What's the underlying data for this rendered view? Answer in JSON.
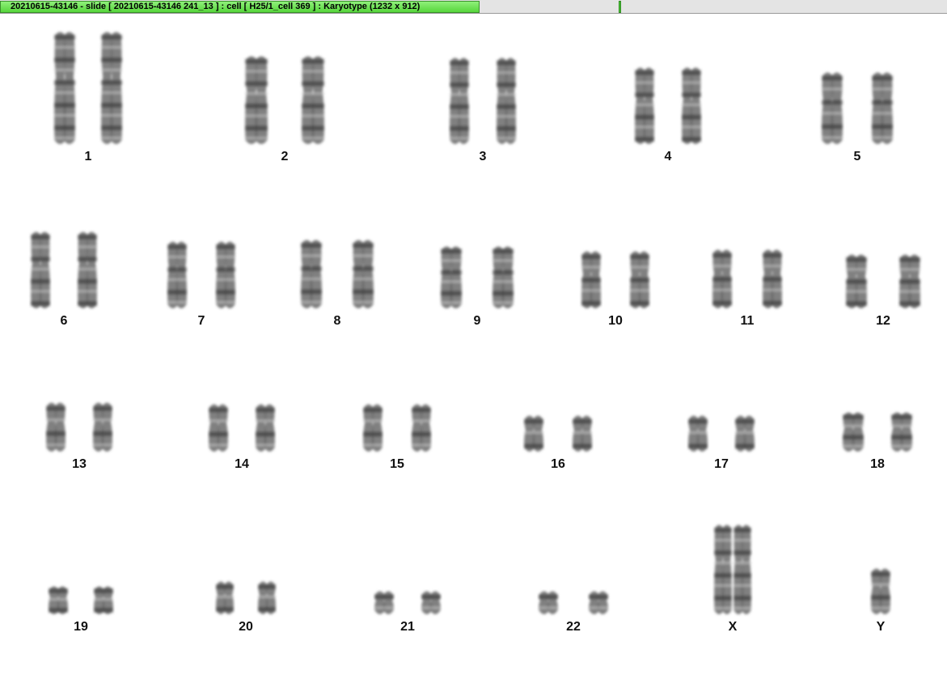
{
  "window": {
    "title": "20210615-43146 - slide [ 20210615-43146 241_13 ] : cell [ H25/1_cell 369 ] : Karyotype  (1232 x 912)"
  },
  "karyotype": {
    "labels": [
      "1",
      "2",
      "3",
      "4",
      "5",
      "6",
      "7",
      "8",
      "9",
      "10",
      "11",
      "12",
      "13",
      "14",
      "15",
      "16",
      "17",
      "18",
      "19",
      "20",
      "21",
      "22",
      "X",
      "Y"
    ]
  }
}
